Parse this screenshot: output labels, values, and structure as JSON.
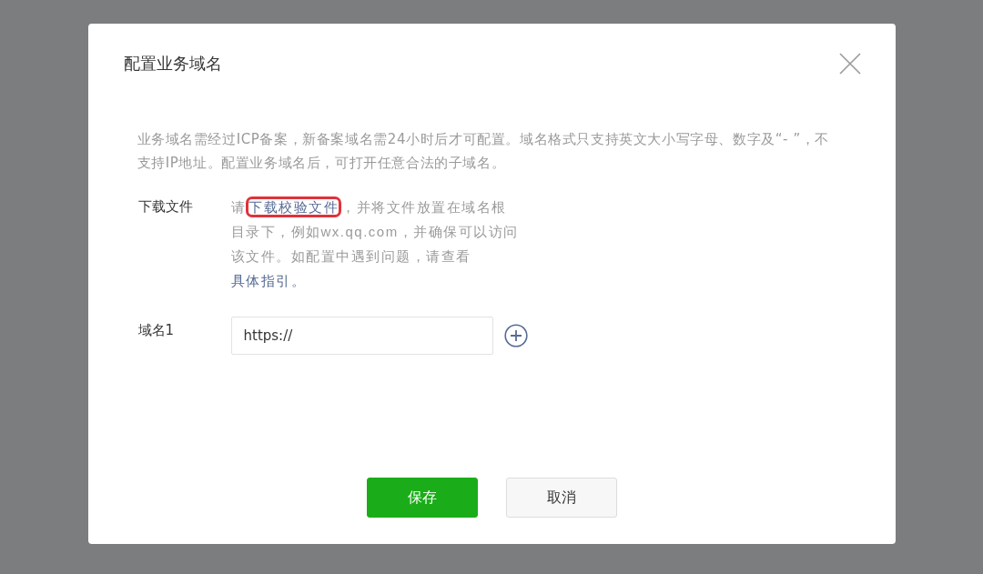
{
  "dialog": {
    "title": "配置业务域名",
    "description": "业务域名需经过ICP备案，新备案域名需24小时后才可配置。域名格式只支持英文大小写字母、数字及“- ”，不支持IP地址。配置业务域名后，可打开任意合法的子域名。",
    "download": {
      "label": "下载文件",
      "prefix": "请",
      "link": {
        "text": "下载校验文件",
        "highlighted": true
      },
      "middle": "，并将文件放置在域名根目录下，例如wx.qq.com，并确保可以访问该文件。如配置中遇到问题，请查看",
      "guide_link": "具体指引。"
    },
    "domains": [
      {
        "label": "域名1",
        "value": "https://"
      }
    ],
    "buttons": [
      {
        "label": "保存",
        "kind": "primary"
      },
      {
        "label": "取消",
        "kind": "default"
      }
    ]
  }
}
